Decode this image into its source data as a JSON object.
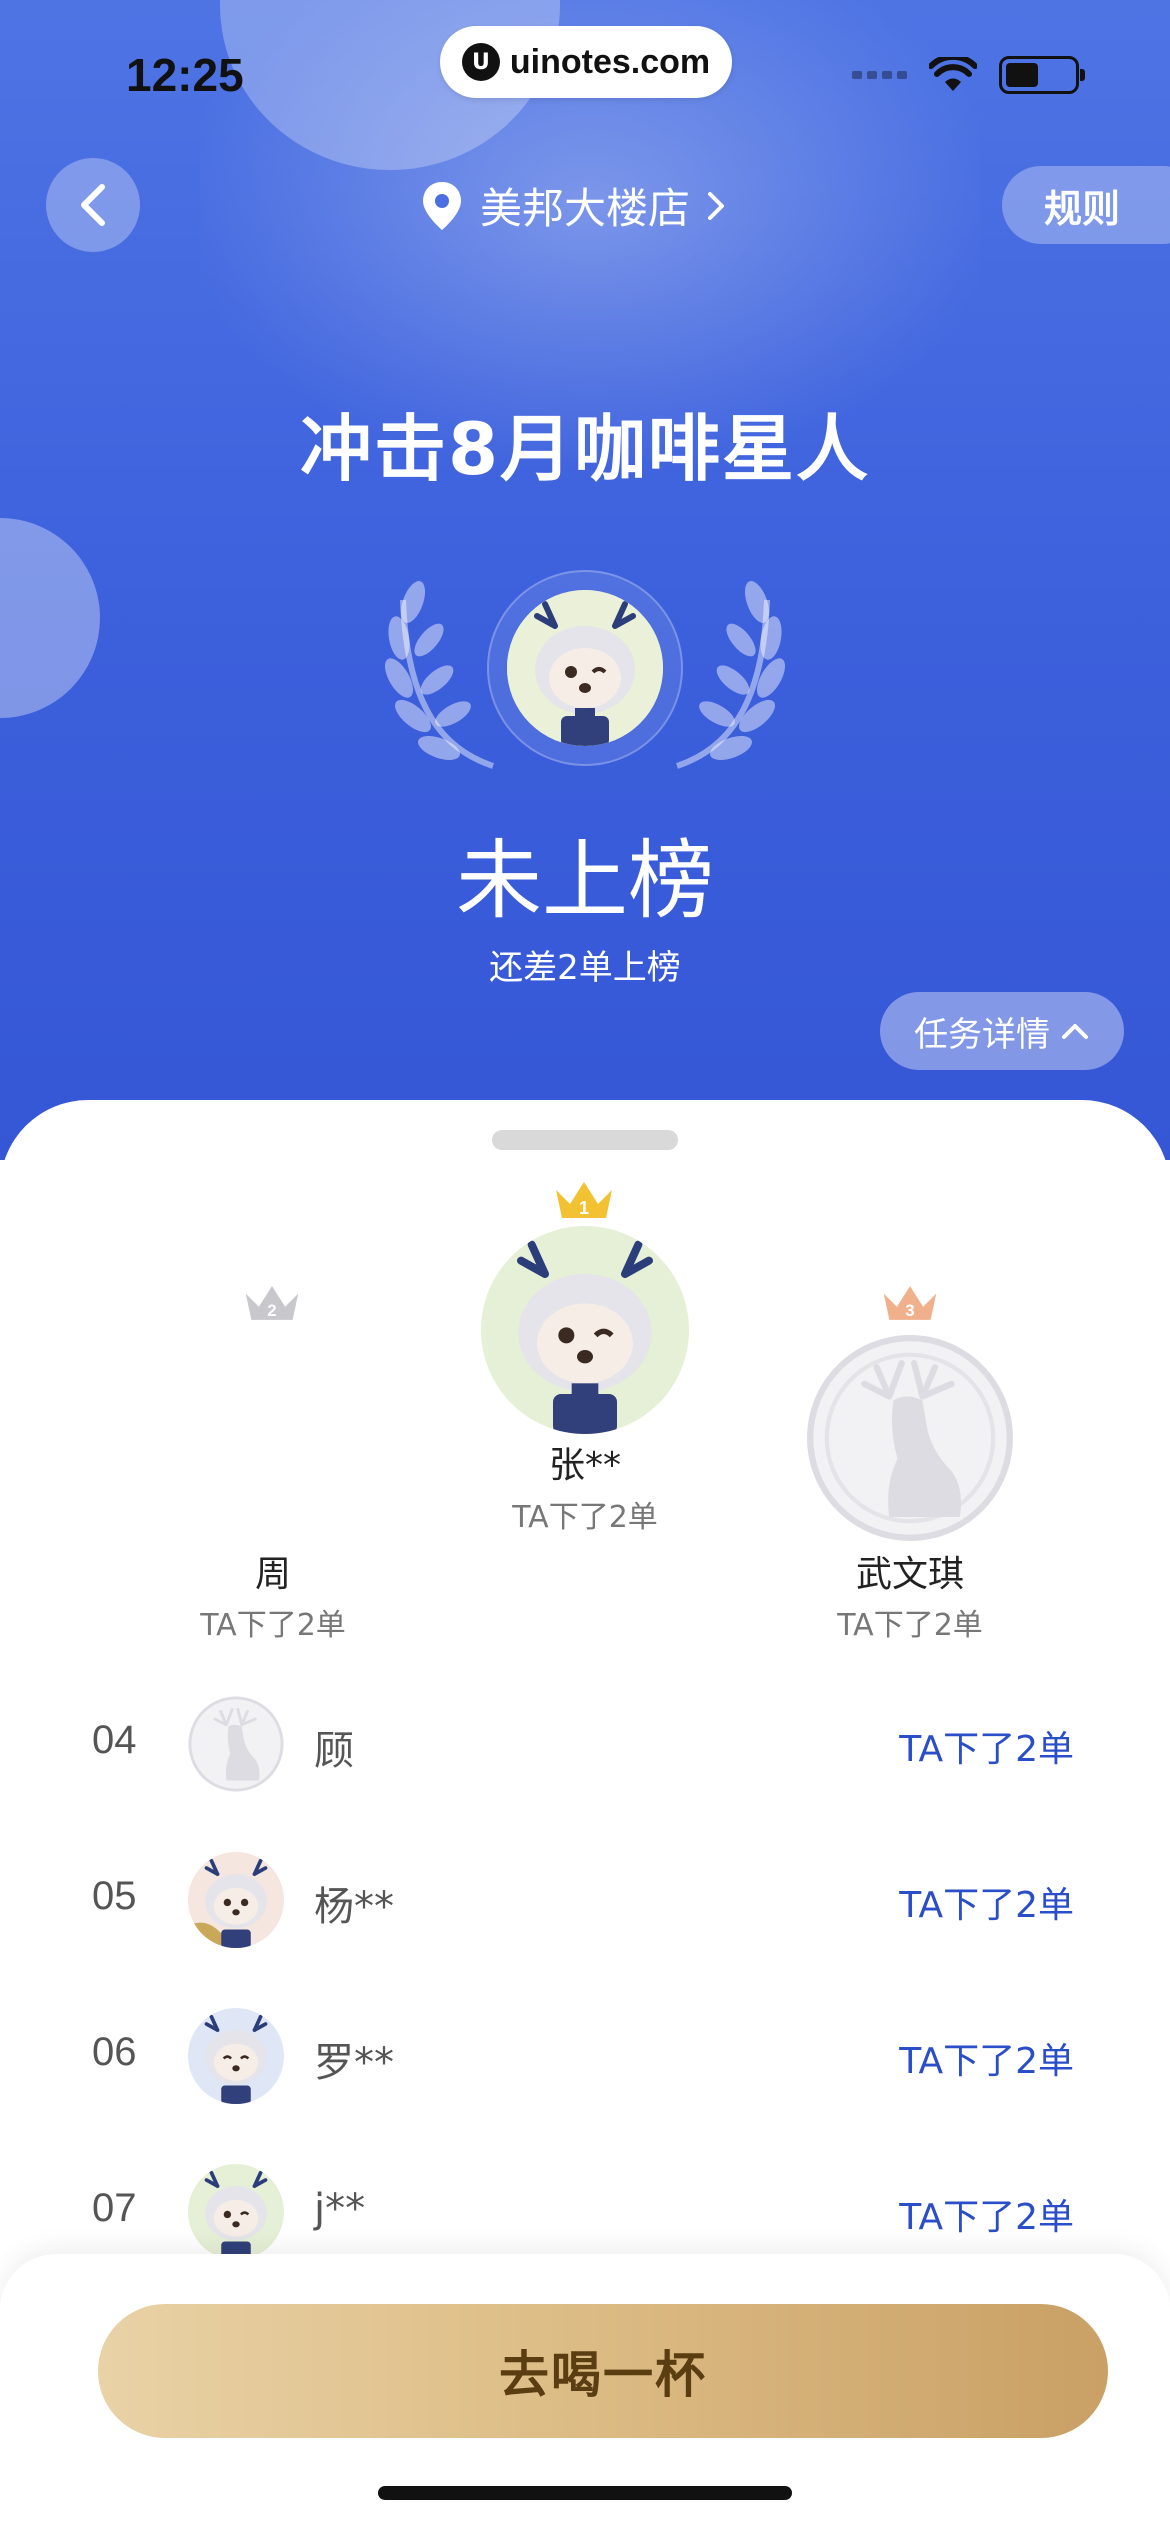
{
  "status_bar": {
    "time": "12:25",
    "url": "uinotes.com"
  },
  "header": {
    "store_name": "美邦大楼店",
    "rules_label": "规则"
  },
  "campaign": {
    "title": "冲击8月咖啡星人",
    "rank_status": "未上榜",
    "rank_subtitle": "还差2单上榜",
    "task_details_label": "任务详情"
  },
  "podium": {
    "first": {
      "rank": "1",
      "name": "张**",
      "orders": "TA下了2单"
    },
    "second": {
      "rank": "2",
      "name": "周",
      "orders": "TA下了2单"
    },
    "third": {
      "rank": "3",
      "name": "武文琪",
      "orders": "TA下了2单"
    }
  },
  "leaderboard": [
    {
      "rank": "04",
      "name": "顾",
      "orders": "TA下了2单",
      "avatar": "deer-placeholder"
    },
    {
      "rank": "05",
      "name": "杨**",
      "orders": "TA下了2单",
      "avatar": "mascot"
    },
    {
      "rank": "06",
      "name": "罗**",
      "orders": "TA下了2单",
      "avatar": "mascot"
    },
    {
      "rank": "07",
      "name": "j**",
      "orders": "TA下了2单",
      "avatar": "mascot"
    }
  ],
  "cta": {
    "label": "去喝一杯"
  },
  "colors": {
    "hero_blue": "#3c5fdc",
    "accent_blue": "#2a4dc8",
    "gold": "#ddbd86",
    "crown_gold": "#f2c232",
    "crown_silver": "#c8c8cc",
    "crown_bronze": "#f0b08c"
  }
}
